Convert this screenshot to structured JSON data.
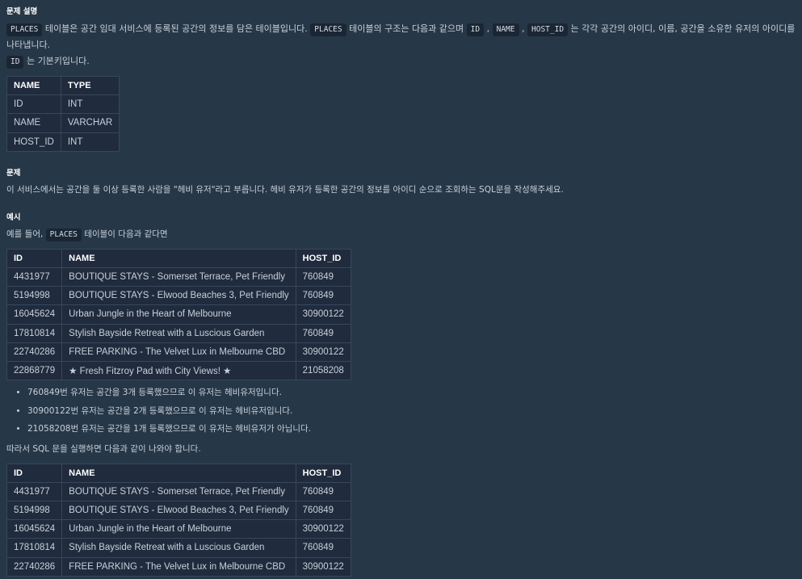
{
  "desc": {
    "title": "문제 설명",
    "code_places": "PLACES",
    "t1": " 테이블은 공간 임대 서비스에 등록된 공간의 정보를 담은 테이블입니다. ",
    "code_places2": "PLACES",
    "t2": " 테이블의 구조는 다음과 같으며 ",
    "code_id": "ID",
    "comma1": " , ",
    "code_name": "NAME",
    "comma2": " , ",
    "code_host_id": "HOST_ID",
    "t3": " 는 각각 공간의 아이디, 이름, 공간을 소유한 유저의 아이디를 나타냅니다.",
    "code_id2": "ID",
    "t4": " 는 기본키입니다."
  },
  "schema": {
    "headers": [
      "NAME",
      "TYPE"
    ],
    "rows": [
      [
        "ID",
        "INT"
      ],
      [
        "NAME",
        "VARCHAR"
      ],
      [
        "HOST_ID",
        "INT"
      ]
    ]
  },
  "problem": {
    "title": "문제",
    "text": "이 서비스에서는 공간을 둘 이상 등록한 사람을 \"헤비 유저\"라고 부릅니다. 헤비 유저가 등록한 공간의 정보를 아이디 순으로 조회하는 SQL문을 작성해주세요."
  },
  "example": {
    "title": "예시",
    "intro_pre": "예를 들어, ",
    "intro_code": "PLACES",
    "intro_post": " 테이블이 다음과 같다면",
    "headers": [
      "ID",
      "NAME",
      "HOST_ID"
    ],
    "rows": [
      [
        "4431977",
        "BOUTIQUE STAYS - Somerset Terrace, Pet Friendly",
        "760849"
      ],
      [
        "5194998",
        "BOUTIQUE STAYS - Elwood Beaches 3, Pet Friendly",
        "760849"
      ],
      [
        "16045624",
        "Urban Jungle in the Heart of Melbourne",
        "30900122"
      ],
      [
        "17810814",
        "Stylish Bayside Retreat with a Luscious Garden",
        "760849"
      ],
      [
        "22740286",
        "FREE PARKING - The Velvet Lux in Melbourne CBD",
        "30900122"
      ],
      [
        "22868779",
        "★ Fresh Fitzroy Pad with City Views! ★",
        "21058208"
      ]
    ],
    "notes": [
      "760849번 유저는 공간을 3개 등록했으므로 이 유저는 헤비유저입니다.",
      "30900122번 유저는 공간을 2개 등록했으므로 이 유저는 헤비유저입니다.",
      "21058208번 유저는 공간을 1개 등록했으므로 이 유저는 헤비유저가 아닙니다."
    ],
    "result_intro": "따라서 SQL 문을 실행하면 다음과 같이 나와야 합니다.",
    "result_headers": [
      "ID",
      "NAME",
      "HOST_ID"
    ],
    "result_rows": [
      [
        "4431977",
        "BOUTIQUE STAYS - Somerset Terrace, Pet Friendly",
        "760849"
      ],
      [
        "5194998",
        "BOUTIQUE STAYS - Elwood Beaches 3, Pet Friendly",
        "760849"
      ],
      [
        "16045624",
        "Urban Jungle in the Heart of Melbourne",
        "30900122"
      ],
      [
        "17810814",
        "Stylish Bayside Retreat with a Luscious Garden",
        "760849"
      ],
      [
        "22740286",
        "FREE PARKING - The Velvet Lux in Melbourne CBD",
        "30900122"
      ]
    ]
  }
}
